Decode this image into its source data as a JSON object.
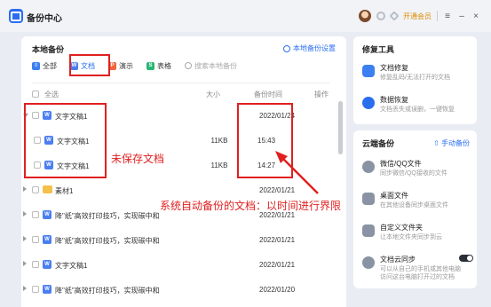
{
  "app": {
    "title": "备份中心",
    "vip_label": "开通会员",
    "menu_glyph": "≡",
    "min_glyph": "–",
    "close_glyph": "×"
  },
  "local": {
    "title": "本地备份",
    "setting_label": "本地备份设置",
    "filters": [
      {
        "label": "全部",
        "icon": "all-icon",
        "color": "#3c7ff0"
      },
      {
        "label": "文档",
        "icon": "word-icon",
        "color": "#4a7ef2"
      },
      {
        "label": "演示",
        "icon": "ppt-icon",
        "color": "#f0663c"
      },
      {
        "label": "表格",
        "icon": "excel-icon",
        "color": "#2bb673"
      }
    ],
    "search_placeholder": "搜索本地备份",
    "columns": {
      "select_all": "全选",
      "size": "大小",
      "time": "备份时间",
      "action": "操作"
    },
    "rows": [
      {
        "type": "word",
        "expanded": true,
        "name": "文字文稿1",
        "size": "",
        "time": "2022/01/24"
      },
      {
        "type": "word-child",
        "name": "文字文稿1",
        "size": "11KB",
        "time": "15:43"
      },
      {
        "type": "word-child",
        "name": "文字文稿1",
        "size": "11KB",
        "time": "14:27"
      },
      {
        "type": "folder",
        "name": "素材1",
        "size": "",
        "time": "2022/01/21"
      },
      {
        "type": "word",
        "name": "降\"纸\"高效打印技巧，实现碳中和",
        "size": "",
        "time": "2022/01/21"
      },
      {
        "type": "word",
        "name": "降\"纸\"高效打印技巧，实现碳中和",
        "size": "",
        "time": "2022/01/21"
      },
      {
        "type": "word",
        "name": "文字文稿1",
        "size": "",
        "time": "2022/01/21"
      },
      {
        "type": "word",
        "name": "降\"纸\"高效打印技巧，实现碳中和",
        "size": "",
        "time": "2022/01/20"
      }
    ]
  },
  "repair": {
    "title": "修复工具",
    "items": [
      {
        "title": "文档修复",
        "desc": "修复乱码/无法打开的文档",
        "icon": "doc-repair-icon",
        "color": "#3c7ff0"
      },
      {
        "title": "数据恢复",
        "desc": "文档丢失或误删，一键恢复",
        "icon": "data-recover-icon",
        "color": "#2a6ef0"
      }
    ]
  },
  "cloud": {
    "title": "云端备份",
    "manual_label": "手动备份",
    "items": [
      {
        "title": "微信/QQ文件",
        "desc": "同步微信/QQ接收的文件",
        "icon": "wechat-icon",
        "color": "#8a93a3"
      },
      {
        "title": "桌面文件",
        "desc": "在其他设备同步桌面文件",
        "icon": "desktop-icon",
        "color": "#8a93a3"
      },
      {
        "title": "自定义文件夹",
        "desc": "让本地文件夹同步到云",
        "icon": "folder-sync-icon",
        "color": "#8a93a3"
      },
      {
        "title": "文档云同步",
        "desc": "可以从自己的手机或其他电脑",
        "desc2": "访问这台电脑打开过的文档",
        "icon": "cloud-sync-icon",
        "color": "#8a93a3",
        "toggle_on": true
      }
    ]
  },
  "annotations": {
    "unsaved": "未保存文档",
    "auto_backup": "系统自动备份的文档：以时间进行界限"
  }
}
